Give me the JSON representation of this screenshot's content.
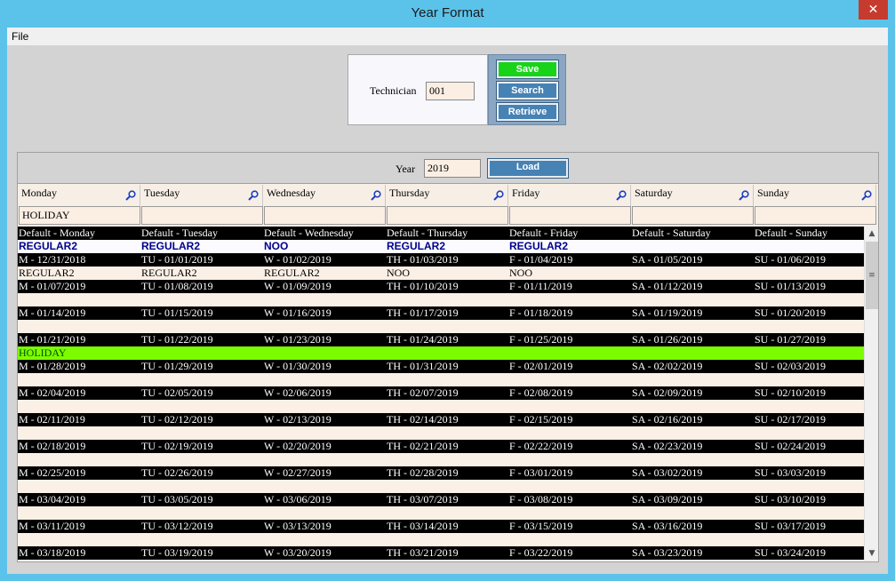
{
  "window": {
    "title": "Year Format",
    "close_label": "✕"
  },
  "menu": {
    "file": "File"
  },
  "technician": {
    "label": "Technician",
    "value": "001"
  },
  "actions": {
    "save": "Save",
    "search": "Search",
    "retrieve": "Retrieve"
  },
  "year": {
    "label": "Year",
    "value": "2019",
    "load": "Load"
  },
  "days": [
    "Monday",
    "Tuesday",
    "Wednesday",
    "Thursday",
    "Friday",
    "Saturday",
    "Sunday"
  ],
  "filters": [
    "HOLIDAY",
    "",
    "",
    "",
    "",
    "",
    ""
  ],
  "rows": [
    {
      "style": "black",
      "cells": [
        "Default - Monday",
        "Default - Tuesday",
        "Default - Wednesday",
        "Default - Thursday",
        "Default - Friday",
        "Default - Saturday",
        "Default - Sunday"
      ]
    },
    {
      "style": "white bold-blue",
      "cells": [
        "REGULAR2",
        "REGULAR2",
        "NOO",
        "REGULAR2",
        "REGULAR2",
        "",
        ""
      ]
    },
    {
      "style": "black",
      "cells": [
        "M - 12/31/2018",
        "TU - 01/01/2019",
        "W - 01/02/2019",
        "TH - 01/03/2019",
        "F - 01/04/2019",
        "SA - 01/05/2019",
        "SU - 01/06/2019"
      ]
    },
    {
      "style": "cream",
      "cells": [
        "REGULAR2",
        "REGULAR2",
        "REGULAR2",
        "NOO",
        "NOO",
        "",
        ""
      ]
    },
    {
      "style": "black",
      "cells": [
        "M - 01/07/2019",
        "TU - 01/08/2019",
        "W - 01/09/2019",
        "TH - 01/10/2019",
        "F - 01/11/2019",
        "SA - 01/12/2019",
        "SU - 01/13/2019"
      ]
    },
    {
      "style": "cream",
      "cells": [
        "",
        "",
        "",
        "",
        "",
        "",
        ""
      ]
    },
    {
      "style": "black",
      "cells": [
        "M - 01/14/2019",
        "TU - 01/15/2019",
        "W - 01/16/2019",
        "TH - 01/17/2019",
        "F - 01/18/2019",
        "SA - 01/19/2019",
        "SU - 01/20/2019"
      ]
    },
    {
      "style": "cream",
      "cells": [
        "",
        "",
        "",
        "",
        "",
        "",
        ""
      ]
    },
    {
      "style": "black",
      "cells": [
        "M - 01/21/2019",
        "TU - 01/22/2019",
        "W - 01/23/2019",
        "TH - 01/24/2019",
        "F - 01/25/2019",
        "SA - 01/26/2019",
        "SU - 01/27/2019"
      ]
    },
    {
      "style": "green",
      "cells": [
        "HOLIDAY",
        "",
        "",
        "",
        "",
        "",
        ""
      ]
    },
    {
      "style": "black",
      "cells": [
        "M - 01/28/2019",
        "TU - 01/29/2019",
        "W - 01/30/2019",
        "TH - 01/31/2019",
        "F - 02/01/2019",
        "SA - 02/02/2019",
        "SU - 02/03/2019"
      ]
    },
    {
      "style": "cream",
      "cells": [
        "",
        "",
        "",
        "",
        "",
        "",
        ""
      ]
    },
    {
      "style": "black",
      "cells": [
        "M - 02/04/2019",
        "TU - 02/05/2019",
        "W - 02/06/2019",
        "TH - 02/07/2019",
        "F - 02/08/2019",
        "SA - 02/09/2019",
        "SU - 02/10/2019"
      ]
    },
    {
      "style": "cream",
      "cells": [
        "",
        "",
        "",
        "",
        "",
        "",
        ""
      ]
    },
    {
      "style": "black",
      "cells": [
        "M - 02/11/2019",
        "TU - 02/12/2019",
        "W - 02/13/2019",
        "TH - 02/14/2019",
        "F - 02/15/2019",
        "SA - 02/16/2019",
        "SU - 02/17/2019"
      ]
    },
    {
      "style": "cream",
      "cells": [
        "",
        "",
        "",
        "",
        "",
        "",
        ""
      ]
    },
    {
      "style": "black",
      "cells": [
        "M - 02/18/2019",
        "TU - 02/19/2019",
        "W - 02/20/2019",
        "TH - 02/21/2019",
        "F - 02/22/2019",
        "SA - 02/23/2019",
        "SU - 02/24/2019"
      ]
    },
    {
      "style": "cream",
      "cells": [
        "",
        "",
        "",
        "",
        "",
        "",
        ""
      ]
    },
    {
      "style": "black",
      "cells": [
        "M - 02/25/2019",
        "TU - 02/26/2019",
        "W - 02/27/2019",
        "TH - 02/28/2019",
        "F - 03/01/2019",
        "SA - 03/02/2019",
        "SU - 03/03/2019"
      ]
    },
    {
      "style": "cream",
      "cells": [
        "",
        "",
        "",
        "",
        "",
        "",
        ""
      ]
    },
    {
      "style": "black",
      "cells": [
        "M - 03/04/2019",
        "TU - 03/05/2019",
        "W - 03/06/2019",
        "TH - 03/07/2019",
        "F - 03/08/2019",
        "SA - 03/09/2019",
        "SU - 03/10/2019"
      ]
    },
    {
      "style": "cream",
      "cells": [
        "",
        "",
        "",
        "",
        "",
        "",
        ""
      ]
    },
    {
      "style": "black",
      "cells": [
        "M - 03/11/2019",
        "TU - 03/12/2019",
        "W - 03/13/2019",
        "TH - 03/14/2019",
        "F - 03/15/2019",
        "SA - 03/16/2019",
        "SU - 03/17/2019"
      ]
    },
    {
      "style": "cream",
      "cells": [
        "",
        "",
        "",
        "",
        "",
        "",
        ""
      ]
    },
    {
      "style": "black",
      "cells": [
        "M - 03/18/2019",
        "TU - 03/19/2019",
        "W - 03/20/2019",
        "TH - 03/21/2019",
        "F - 03/22/2019",
        "SA - 03/23/2019",
        "SU - 03/24/2019"
      ]
    }
  ],
  "scrollbar": {
    "up": "▲",
    "down": "▼",
    "grip": "≡"
  },
  "colors": {
    "title_bar": "#5bc3ea",
    "save": "#19d319",
    "button": "#4682b4",
    "holiday": "#7cfc00"
  },
  "icons": {
    "column_search": "magnifier-icon"
  }
}
